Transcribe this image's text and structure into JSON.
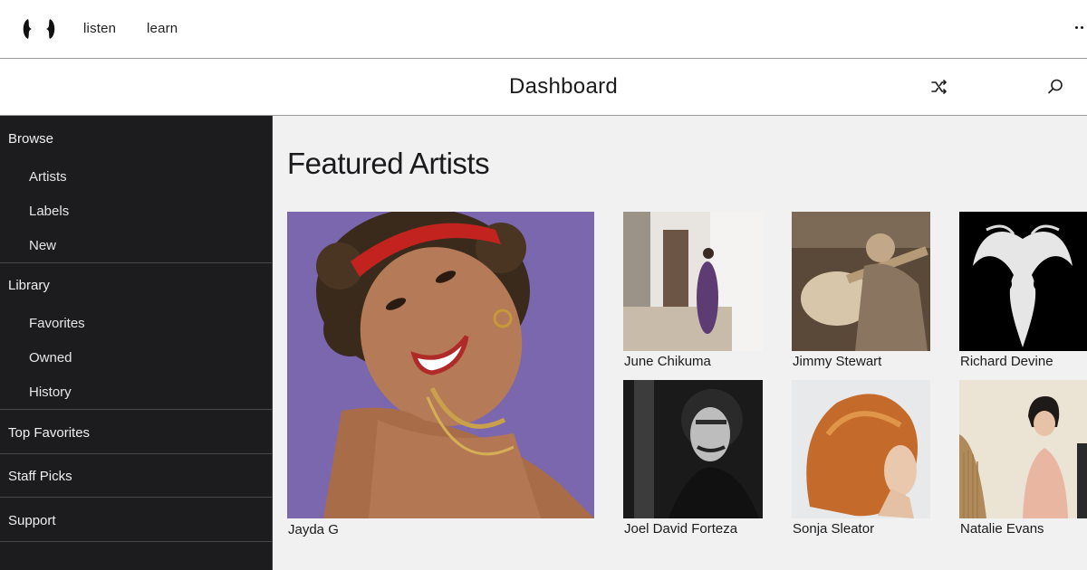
{
  "nav": {
    "logo_icon": "bandcamp-style-logo-icon",
    "links": [
      {
        "label": "listen"
      },
      {
        "label": "learn"
      }
    ],
    "more_icon": "more-dots-icon"
  },
  "titlebar": {
    "title": "Dashboard",
    "shuffle_icon": "shuffle-icon",
    "search_icon": "search-icon"
  },
  "sidebar": {
    "sections": [
      {
        "label": "Browse",
        "items": [
          {
            "label": "Artists"
          },
          {
            "label": "Labels"
          },
          {
            "label": "New"
          }
        ]
      },
      {
        "label": "Library",
        "items": [
          {
            "label": "Favorites"
          },
          {
            "label": "Owned"
          },
          {
            "label": "History"
          }
        ]
      },
      {
        "label": "Top Favorites",
        "items": []
      },
      {
        "label": "Staff Picks",
        "items": []
      },
      {
        "label": "Support",
        "items": []
      }
    ]
  },
  "main": {
    "heading": "Featured Artists",
    "featured": {
      "name": "Jayda G"
    },
    "artists": [
      {
        "name": "June Chikuma"
      },
      {
        "name": "Jimmy Stewart"
      },
      {
        "name": "Richard Devine"
      },
      {
        "name": "Joel David Forteza"
      },
      {
        "name": "Sonja Sleator"
      },
      {
        "name": "Natalie Evans"
      }
    ]
  },
  "colors": {
    "sidebar_bg": "#1c1c1e",
    "main_bg": "#f1f1f2",
    "nav_bg": "#ffffff",
    "featured_bg": "#7b67ad"
  }
}
